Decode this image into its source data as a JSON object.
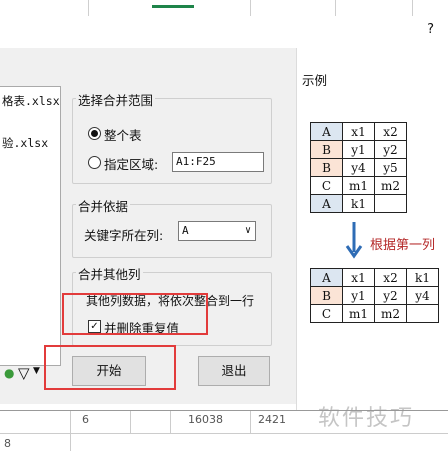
{
  "dialog": {
    "help": "?",
    "files": [
      "格表.xlsx",
      "验.xlsx"
    ],
    "range_group": {
      "title": "选择合并范围",
      "whole_sheet": "整个表",
      "region": "指定区域:",
      "region_value": "A1:F25"
    },
    "basis_group": {
      "title": "合并依据",
      "key_col_label": "关键字所在列:",
      "key_col_value": "A"
    },
    "other_group": {
      "title": "合并其他列",
      "desc": "其他列数据，将依次整合到一行",
      "dedupe": "并删除重复值"
    },
    "start_button": "开始",
    "exit_button": "退出"
  },
  "example": {
    "title": "示例",
    "before": [
      [
        "A",
        "x1",
        "x2"
      ],
      [
        "B",
        "y1",
        "y2"
      ],
      [
        "B",
        "y4",
        "y5"
      ],
      [
        "C",
        "m1",
        "m2"
      ],
      [
        "A",
        "k1",
        ""
      ]
    ],
    "arrow_label": "根据第一列",
    "after": [
      [
        "A",
        "x1",
        "x2",
        "k1"
      ],
      [
        "B",
        "y1",
        "y2",
        "y4"
      ],
      [
        "C",
        "m1",
        "m2",
        ""
      ]
    ]
  },
  "sheet_bottom": {
    "cell1": "6",
    "cell2": "16038",
    "cell3": "2421",
    "sheet_tab": "8"
  },
  "watermark": "软件技巧",
  "colors": {
    "highlight_red": "#e23b3b",
    "key_blue": "#dce6f1",
    "key_pink": "#fbe4d6",
    "arrow_blue": "#2e6cb5",
    "arrow_text": "#b42828"
  }
}
